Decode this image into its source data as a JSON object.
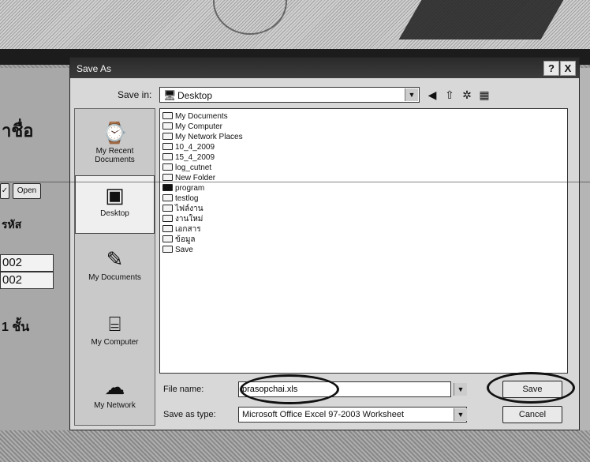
{
  "dialog": {
    "title": "Save As",
    "help_label": "?",
    "close_label": "X",
    "save_in": {
      "label": "Save in:",
      "value": "Desktop",
      "icon": "desktop-icon"
    },
    "toolbar": {
      "back": "◀",
      "up": "⇧",
      "new_folder": "✲",
      "views": "▦"
    },
    "places": [
      {
        "label": "My Recent Documents",
        "icon": "clock-document-icon",
        "glyph": "⌚"
      },
      {
        "label": "Desktop",
        "icon": "desktop-folder-icon",
        "glyph": "▣"
      },
      {
        "label": "My Documents",
        "icon": "documents-folder-icon",
        "glyph": "✎"
      },
      {
        "label": "My Computer",
        "icon": "computer-icon",
        "glyph": "⌸"
      },
      {
        "label": "My Network",
        "icon": "network-icon",
        "glyph": "☁"
      }
    ],
    "files": [
      "My Documents",
      "My Computer",
      "My Network Places",
      "10_4_2009",
      "15_4_2009",
      "log_cutnet",
      "New Folder",
      "program",
      "testlog",
      "ไฟล์งาน",
      "งานใหม่",
      "เอกสาร",
      "ข้อมูล",
      "Save"
    ],
    "file_name": {
      "label": "File name:",
      "value": "prasopchai.xls"
    },
    "save_as_type": {
      "label": "Save as type:",
      "value": "Microsoft Office Excel 97-2003 Worksheet"
    },
    "save_label": "Save",
    "cancel_label": "Cancel"
  },
  "background": {
    "heading_fragment": "าชื่อ",
    "button_fragment": "Open",
    "cells": [
      "002",
      "002"
    ],
    "row_fragment": "1 ชั้น",
    "col_fragment": "รหัส"
  }
}
